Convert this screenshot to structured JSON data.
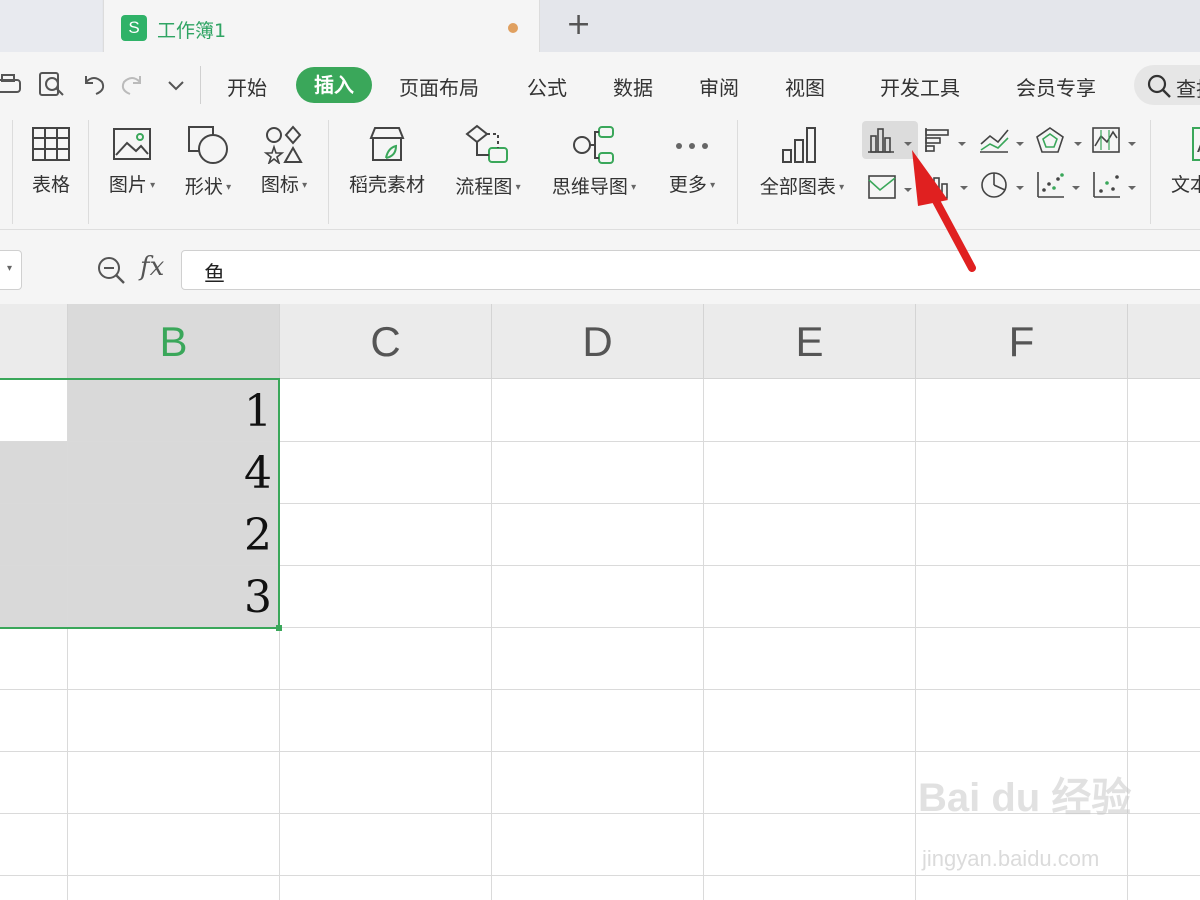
{
  "tabbar": {
    "tab_icon_letter": "S",
    "tab_title": "工作簿1",
    "new_tab_label": "+"
  },
  "menu": {
    "items": [
      "开始",
      "插入",
      "页面布局",
      "公式",
      "数据",
      "审阅",
      "视图",
      "开发工具",
      "会员专享"
    ],
    "active": "插入",
    "search_label": "查找"
  },
  "ribbon": {
    "table": "表格",
    "picture": "图片",
    "shape": "形状",
    "icon": "图标",
    "docer": "稻壳素材",
    "flowchart": "流程图",
    "mindmap": "思维导图",
    "more": "更多",
    "all_charts": "全部图表",
    "textbox": "文本"
  },
  "formula": {
    "fx": "fx",
    "value": "鱼"
  },
  "grid": {
    "columns": [
      "B",
      "C",
      "D",
      "E",
      "F"
    ],
    "selected_column": "B",
    "values": [
      "1",
      "4",
      "2",
      "3"
    ]
  },
  "watermark": {
    "brand": "Bai du 经验",
    "url": "jingyan.baidu.com"
  },
  "colors": {
    "accent": "#3aa75a",
    "arrow": "#e02020"
  }
}
